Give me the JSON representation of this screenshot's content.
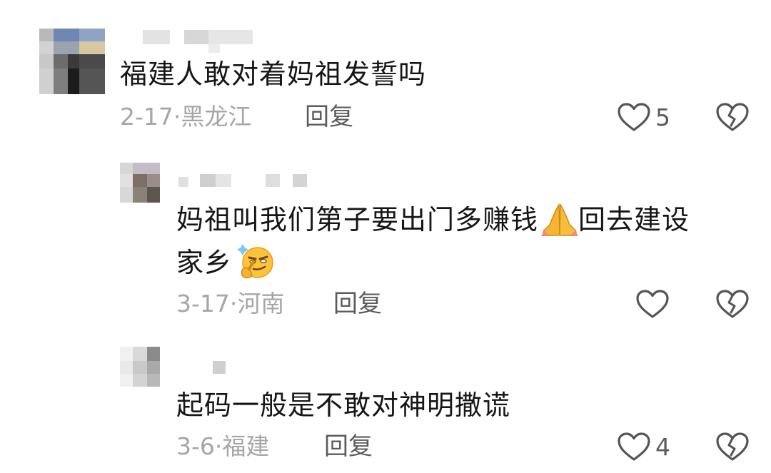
{
  "comments": [
    {
      "text": "福建人敢对着妈祖发誓吗",
      "date": "2-17",
      "location": "黑龙江",
      "reply_label": "回复",
      "like_count": "5"
    },
    {
      "text_line1": "妈祖叫我们第子要出门多赚钱",
      "text_after_emoji": "回去建设",
      "text_line2": "家乡",
      "date": "3-17",
      "location": "河南",
      "reply_label": "回复",
      "like_count": ""
    },
    {
      "text": "起码一般是不敢对神明撒谎",
      "date": "3-6",
      "location": "福建",
      "reply_label": "回复",
      "like_count": "4"
    }
  ],
  "separator": "·",
  "icons": [
    "avatar-pixelated",
    "heart-outline-icon",
    "broken-heart-icon",
    "folded-hands-emoji",
    "smirk-thinking-emoji"
  ],
  "colors": {
    "text": "#161616",
    "meta": "#a6a6a6",
    "action": "#5c5c5c"
  }
}
